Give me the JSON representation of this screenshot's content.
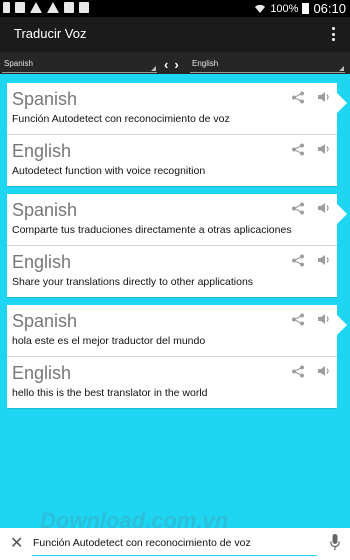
{
  "status_bar": {
    "battery": "100%",
    "time": "06:10",
    "left_icons": [
      "usb-icon",
      "gallery-icon",
      "alert-icon",
      "alert-icon",
      "box-icon",
      "download-icon"
    ],
    "right_icons": [
      "wifi-icon",
      "battery-icon"
    ]
  },
  "app_bar": {
    "title": "Traducir Voz",
    "menu_icon": "overflow-menu-icon"
  },
  "language_bar": {
    "source_language": "Spanish",
    "target_language": "English",
    "swap_icon": "swap-arrows-icon"
  },
  "cards": [
    {
      "source": {
        "language": "Spanish",
        "text": "Función Autodetect con reconocimiento de voz"
      },
      "target": {
        "language": "English",
        "text": "Autodetect function with voice recognition"
      }
    },
    {
      "source": {
        "language": "Spanish",
        "text": "Comparte tus traduciones directamente a otras aplicaciones"
      },
      "target": {
        "language": "English",
        "text": "Share your translations directly to other applications"
      }
    },
    {
      "source": {
        "language": "Spanish",
        "text": "hola este es el mejor traductor del mundo"
      },
      "target": {
        "language": "English",
        "text": "hello this is the best translator in the world"
      }
    }
  ],
  "input_bar": {
    "value": "Función Autodetect con reconocimiento de voz",
    "clear_icon": "close-icon",
    "mic_icon": "microphone-icon"
  },
  "colors": {
    "background": "#1fd6f2",
    "app_bar": "#1b1b1b",
    "card": "#ffffff",
    "accent": "#1fd6f2"
  },
  "watermark": {
    "text": "Download.com.vn"
  }
}
